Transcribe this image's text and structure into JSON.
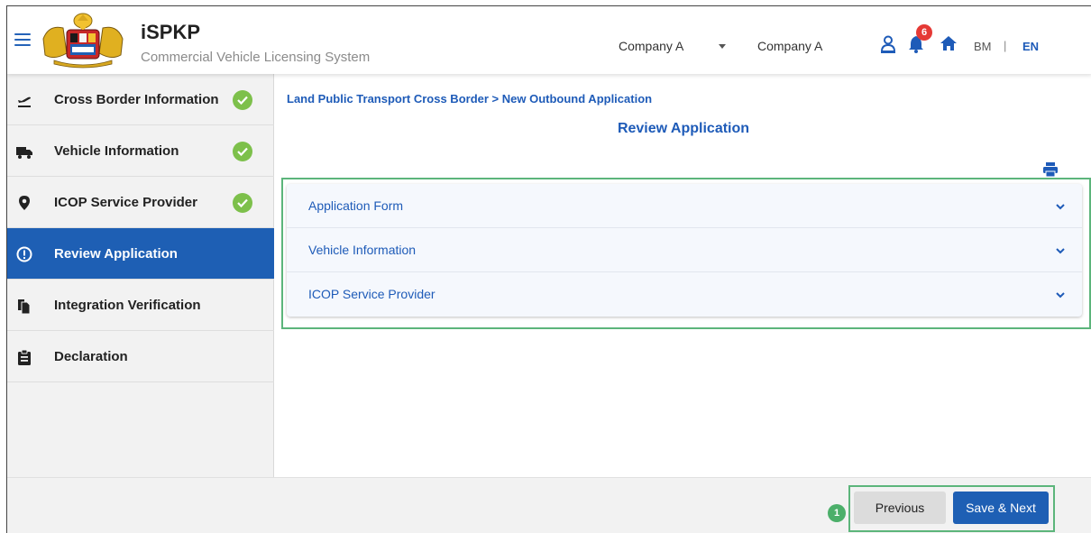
{
  "header": {
    "app_name": "iSPKP",
    "app_subtitle": "Commercial Vehicle Licensing System",
    "company_select_value": "Company A",
    "company_name": "Company A",
    "notification_count": "6",
    "lang_bm": "BM",
    "lang_separator": "|",
    "lang_en": "EN"
  },
  "sidebar": {
    "items": [
      {
        "label": "Cross Border Information",
        "icon": "plane-departure-icon",
        "completed": true
      },
      {
        "label": "Vehicle Information",
        "icon": "truck-icon",
        "completed": true
      },
      {
        "label": "ICOP Service Provider",
        "icon": "map-pin-icon",
        "completed": true
      },
      {
        "label": "Review Application",
        "icon": "alert-circle-icon",
        "active": true
      },
      {
        "label": "Integration Verification",
        "icon": "files-icon"
      },
      {
        "label": "Declaration",
        "icon": "clipboard-icon"
      }
    ]
  },
  "main": {
    "breadcrumb": "Land Public Transport Cross Border > New Outbound Application",
    "title": "Review Application",
    "accordion": [
      {
        "label": "Application Form"
      },
      {
        "label": "Vehicle Information"
      },
      {
        "label": "ICOP Service Provider"
      }
    ]
  },
  "footer": {
    "step_marker": "1",
    "previous_label": "Previous",
    "next_label": "Save & Next"
  },
  "colors": {
    "primary": "#1e5fb4",
    "success": "#7dc04b",
    "highlight": "#5cb57b",
    "badge": "#e53935"
  }
}
